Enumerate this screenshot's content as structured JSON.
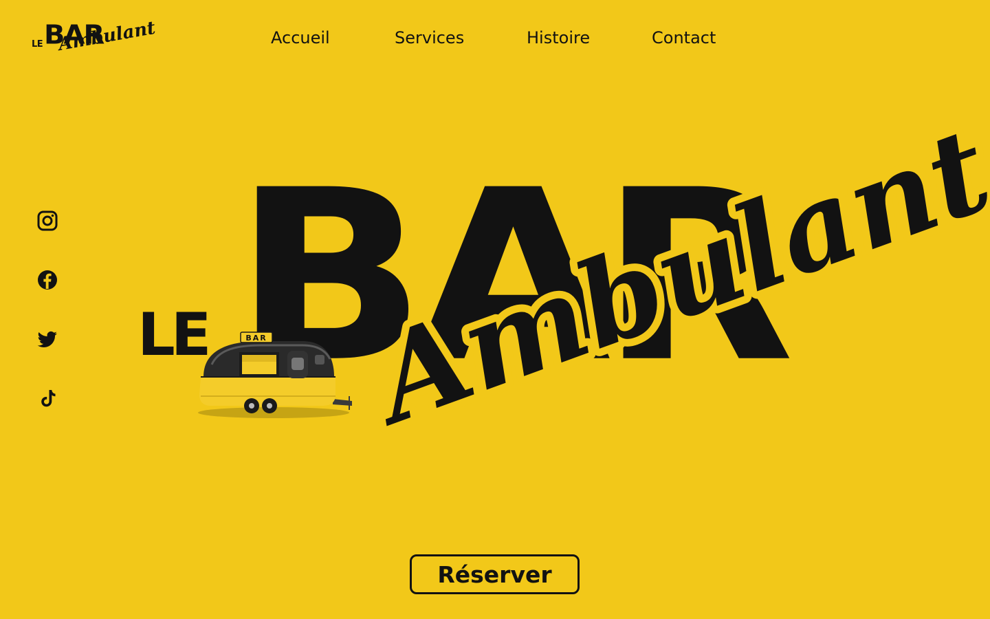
{
  "brand": {
    "logo_le": "LE",
    "logo_bar": "BAR",
    "logo_script": "Ambulant"
  },
  "nav": {
    "items": [
      "Accueil",
      "Services",
      "Histoire",
      "Contact"
    ]
  },
  "social": {
    "icons": [
      "instagram-icon",
      "facebook-icon",
      "twitter-icon",
      "tiktok-icon"
    ]
  },
  "hero": {
    "le": "LE",
    "bar": "BAR",
    "script": "Ambulant",
    "trailer_sign": "BAR"
  },
  "cta": {
    "reserve_label": "Réserver"
  },
  "colors": {
    "background": "#F2C819",
    "ink": "#121212",
    "trailer_body": "#2A2A2A",
    "trailer_stripe": "#F4CC2A"
  }
}
